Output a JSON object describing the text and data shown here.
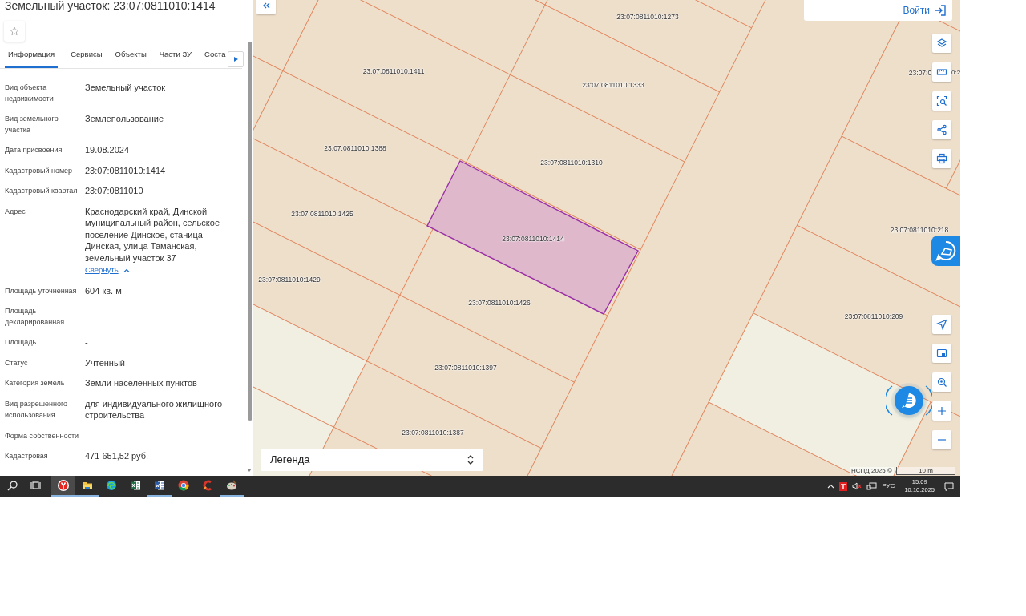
{
  "panel": {
    "title": "Земельный участок: 23:07:0811010:1414",
    "tabs": [
      {
        "label": "Информация",
        "selected": true
      },
      {
        "label": "Сервисы",
        "selected": false
      },
      {
        "label": "Объекты",
        "selected": false
      },
      {
        "label": "Части ЗУ",
        "selected": false
      },
      {
        "label": "Соста",
        "selected": false
      }
    ],
    "fields": [
      {
        "label": "Вид объекта недвижимости",
        "value": "Земельный участок"
      },
      {
        "label": "Вид земельного участка",
        "value": "Землепользование"
      },
      {
        "label": "Дата присвоения",
        "value": "19.08.2024"
      },
      {
        "label": "Кадастровый номер",
        "value": "23:07:0811010:1414"
      },
      {
        "label": "Кадастровый квартал",
        "value": "23:07:0811010"
      },
      {
        "label": "Адрес",
        "value": "Краснодарский край, Динской муниципальный район, сельское поселение Динское, станица Динская, улица Таманская, земельный участок 37",
        "toggle": "Свернуть"
      },
      {
        "label": "Площадь уточненная",
        "value": "604 кв. м"
      },
      {
        "label": "Площадь декларированная",
        "value": "-"
      },
      {
        "label": "Площадь",
        "value": "-"
      },
      {
        "label": "Статус",
        "value": "Учтенный"
      },
      {
        "label": "Категория земель",
        "value": "Земли населенных пунктов"
      },
      {
        "label": "Вид разрешенного использования",
        "value": "для индивидуального жилищного строительства"
      },
      {
        "label": "Форма собственности",
        "value": "-"
      },
      {
        "label": "Кадастровая",
        "value": "471 651,52 руб."
      }
    ]
  },
  "map": {
    "login": "Войти",
    "parcels": [
      "23:07:0811010:1273",
      "23:07:0811010:1411",
      "23:07:0811010:1333",
      "23:07:0",
      "0:2",
      "23:07:0811010:1388",
      "23:07:0811010:1310",
      "23:07:0811010:1425",
      "23:07:0811010:1414",
      "23:07:0811010:218",
      "23:07:0811010:1429",
      "23:07:0811010:1426",
      "23:07:0811010:209",
      "23:07:0811010:1397",
      "23:07:0811010:1387"
    ],
    "legend": "Легенда",
    "attribution": "НСПД 2025 ©",
    "scale": "10 m"
  },
  "taskbar": {
    "apps": [
      {
        "kind": "search",
        "running": false,
        "selected": false
      },
      {
        "kind": "taskview",
        "running": false,
        "selected": false
      },
      {
        "kind": "yandex",
        "running": true,
        "selected": true
      },
      {
        "kind": "explorer",
        "running": true,
        "selected": false
      },
      {
        "kind": "edge",
        "running": false,
        "selected": false
      },
      {
        "kind": "excel",
        "running": false,
        "selected": false
      },
      {
        "kind": "word",
        "running": true,
        "selected": false
      },
      {
        "kind": "chrome",
        "running": false,
        "selected": false
      },
      {
        "kind": "ccleaner",
        "running": false,
        "selected": false
      },
      {
        "kind": "paint",
        "running": true,
        "selected": false
      }
    ],
    "language": "РУС",
    "time": "15:09",
    "date": "10.10.2025"
  }
}
